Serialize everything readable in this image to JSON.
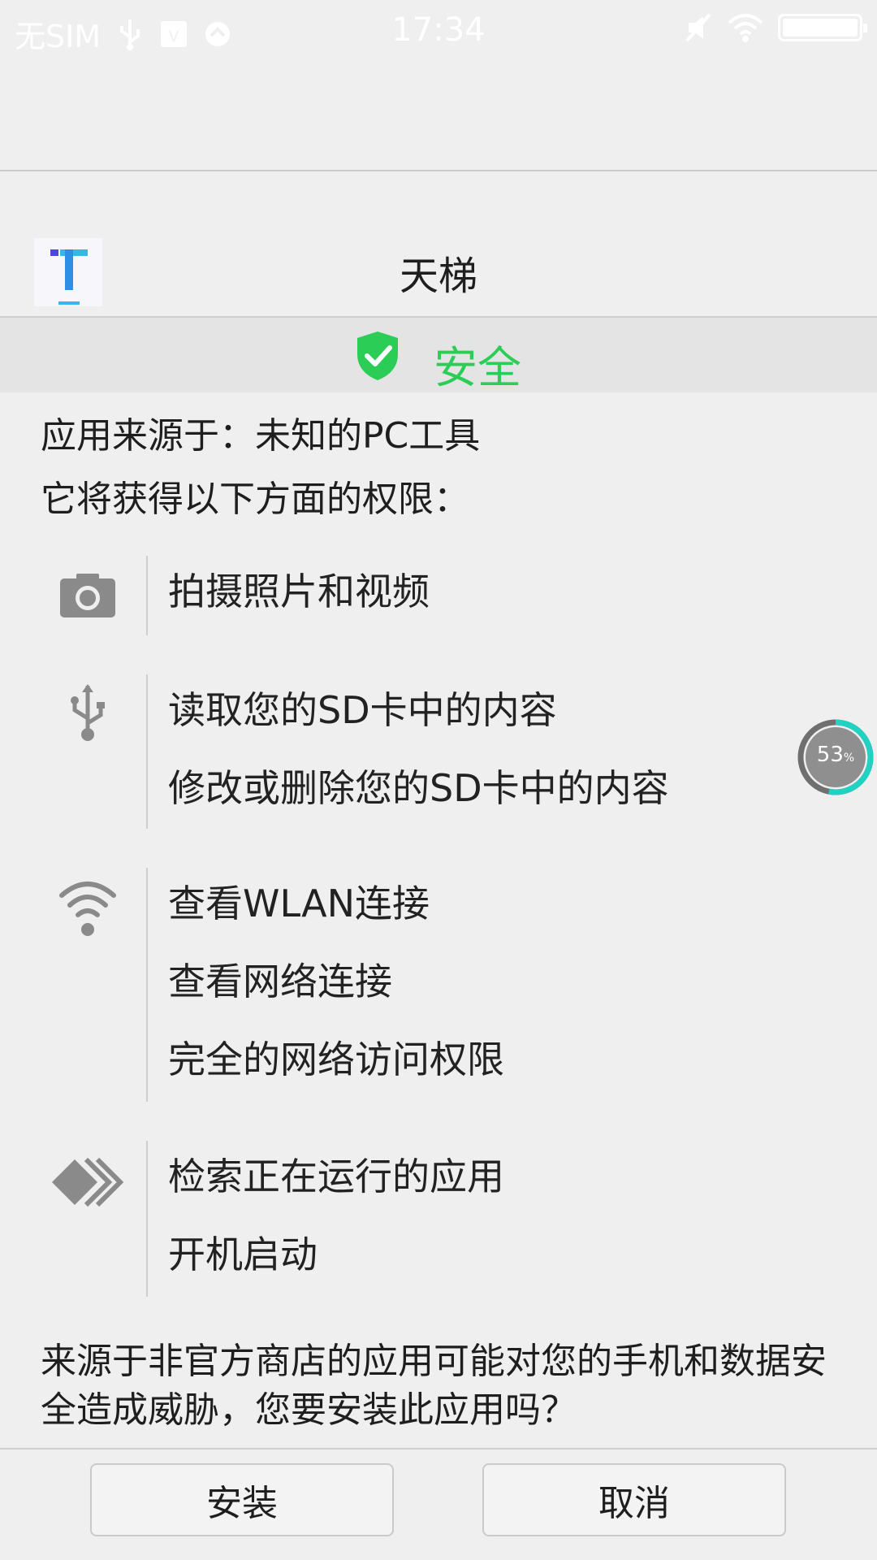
{
  "status_bar": {
    "carrier": "无SIM",
    "time": "17:34"
  },
  "app": {
    "name": "天梯"
  },
  "security": {
    "label": "安全",
    "accent_color": "#2ccd57"
  },
  "source": {
    "text": "应用来源于：未知的PC工具"
  },
  "permissions": {
    "heading": "它将获得以下方面的权限：",
    "groups": [
      {
        "icon": "camera-icon",
        "items": [
          "拍摄照片和视频"
        ]
      },
      {
        "icon": "usb-icon",
        "items": [
          "读取您的SD卡中的内容",
          "修改或删除您的SD卡中的内容"
        ]
      },
      {
        "icon": "wifi-icon",
        "items": [
          "查看WLAN连接",
          "查看网络连接",
          "完全的网络访问权限"
        ]
      },
      {
        "icon": "apps-running-icon",
        "items": [
          "检索正在运行的应用",
          "开机启动"
        ]
      }
    ]
  },
  "warning": {
    "text": "来源于非官方商店的应用可能对您的手机和数据安全造成威胁，您要安装此应用吗？"
  },
  "buttons": {
    "install": "安装",
    "cancel": "取消"
  },
  "float_ball": {
    "value": "53",
    "unit": "%",
    "progress": 0.53,
    "progress_color": "#1fd2c2"
  }
}
